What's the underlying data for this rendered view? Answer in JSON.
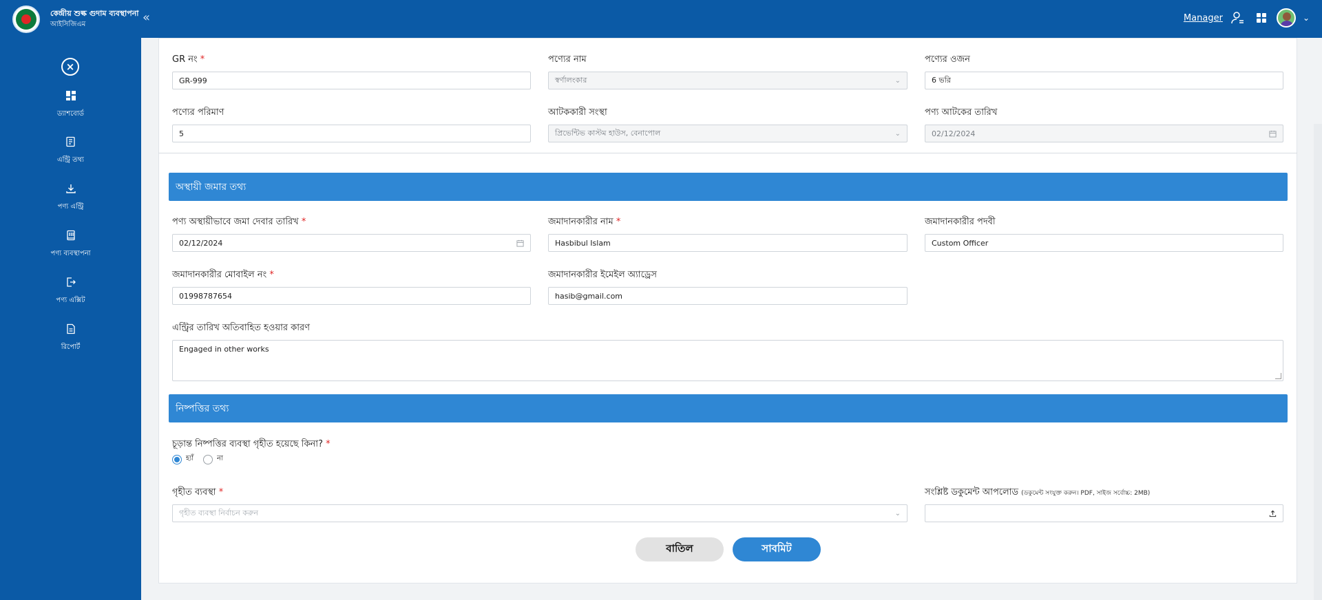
{
  "header": {
    "brand_title": "কেন্দ্রীয় শুল্ক গুদাম ব্যবস্থাপনা",
    "brand_sub": "আইসিজিএম",
    "collapse_glyph": "«",
    "user_label": "Manager"
  },
  "sidebar": {
    "close_glyph": "×",
    "items": [
      {
        "label": "ড্যাশবোর্ড",
        "icon": "dashboard-icon"
      },
      {
        "label": "এন্ট্রি তথ্য",
        "icon": "entry-info-icon"
      },
      {
        "label": "পণ্য এন্ট্রি",
        "icon": "download-icon"
      },
      {
        "label": "পণ্য ব্যবস্থাপনা",
        "icon": "book-icon"
      },
      {
        "label": "পণ্য এক্সিট",
        "icon": "exit-icon"
      },
      {
        "label": "রিপোর্ট",
        "icon": "report-icon"
      }
    ]
  },
  "product": {
    "gr_label": "GR নং",
    "gr_value": "GR-999",
    "name_label": "পণ্যের নাম",
    "name_value": "স্বর্ণালংকার",
    "weight_label": "পণ্যের ওজন",
    "weight_value": "6 ভরি",
    "qty_label": "পণ্যের পরিমাণ",
    "qty_value": "5",
    "org_label": "আটককারী সংস্থা",
    "org_value": "প্রিভেন্টিভ কাস্টম হাউস, বেনাপোল",
    "seize_date_label": "পণ্য আটকের তারিখ",
    "seize_date_value": "02/12/2024"
  },
  "temp_deposit": {
    "section_title": "অস্থায়ী জমার তথ্য",
    "date_label": "পণ্য অস্থায়ীভাবে জমা দেবার তারিখ",
    "date_value": "02/12/2024",
    "depositor_name_label": "জমাদানকারীর নাম",
    "depositor_name_value": "Hasbibul Islam",
    "designation_label": "জমাদানকারীর পদবী",
    "designation_value": "Custom Officer",
    "mobile_label": "জমাদানকারীর মোবাইল নং",
    "mobile_value": "01998787654",
    "email_label": "জমাদানকারীর ইমেইল অ্যাড্রেস",
    "email_value": "hasib@gmail.com",
    "reason_label": "এন্ট্রির তারিখ অতিবাহিত হওয়ার কারণ",
    "reason_value": "Engaged in other works"
  },
  "disposal": {
    "section_title": "নিষ্পত্তির তথ্য",
    "question": "চূড়ান্ত নিষ্পত্তির ব্যবস্থা গৃহীত হয়েছে কিনা?",
    "option_yes": "হ্যাঁ",
    "option_no": "না",
    "action_label": "গৃহীত ব্যবস্থা",
    "action_placeholder": "গৃহীত ব্যবস্থা নির্বাচন করুন",
    "upload_label": "সংশ্লিষ্ট ডকুমেন্ট আপলোড",
    "upload_hint": "(ডকুমেন্ট সংযুক্ত করুন। PDF, সাইজ সর্বোচ্চ: 2MB)"
  },
  "actions": {
    "cancel": "বাতিল",
    "submit": "সাবমিট"
  },
  "colors": {
    "primary": "#0b5aa6",
    "section": "#2f87d4",
    "required": "#e02626"
  }
}
